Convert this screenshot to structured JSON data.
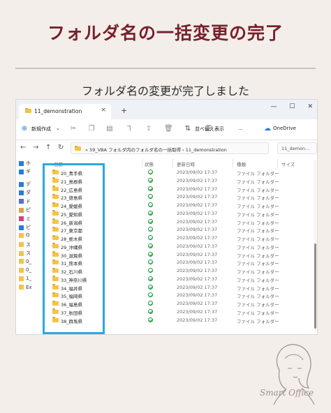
{
  "page": {
    "title": "フォルダ名の一括変更の完了",
    "subtitle": "フォルダ名の変更が完了しました",
    "brand": "Smart Office"
  },
  "window": {
    "tab_title": "11_demonstration",
    "tab_close": "×",
    "new_tab": "+",
    "minimize": "—",
    "maximize": "☐",
    "close": "✕"
  },
  "toolbar": {
    "new_label": "新規作成",
    "sort_label": "並べ替え",
    "view_label": "表示",
    "more_label": "...",
    "onedrive_label": "OneDrive"
  },
  "address": {
    "path": "59_VBA フォルダ内のフォルダ名の一括取得  ›  11_demonstration",
    "ellipsis": "«",
    "search_placeholder": "11_demon..."
  },
  "sidebar": {
    "items": [
      "ホ",
      "ギ",
      "デ",
      "ダ",
      "ド",
      "ピ",
      "ミ",
      "ビ",
      "O",
      "ス",
      "ス",
      "0_",
      "0_",
      "1_",
      "Ex"
    ]
  },
  "columns": {
    "name": "名前",
    "status": "状態",
    "modified": "更新日時",
    "type": "種類",
    "size": "サイズ"
  },
  "rows": [
    {
      "name": "20_青手県",
      "date": "2023/09/02 17:37",
      "type": "ファイル フォルダー"
    },
    {
      "name": "21_島根県",
      "date": "2023/09/02 17:37",
      "type": "ファイル フォルダー"
    },
    {
      "name": "22_広島県",
      "date": "2023/09/02 17:37",
      "type": "ファイル フォルダー"
    },
    {
      "name": "23_德島県",
      "date": "2023/09/02 17:37",
      "type": "ファイル フォルダー"
    },
    {
      "name": "24_愛媛県",
      "date": "2023/09/02 17:37",
      "type": "ファイル フォルダー"
    },
    {
      "name": "25_愛知県",
      "date": "2023/09/02 17:37",
      "type": "ファイル フォルダー"
    },
    {
      "name": "26_新潟県",
      "date": "2023/09/02 17:37",
      "type": "ファイル フォルダー"
    },
    {
      "name": "27_東京都",
      "date": "2023/09/02 17:37",
      "type": "ファイル フォルダー"
    },
    {
      "name": "28_栃木県",
      "date": "2023/09/02 17:37",
      "type": "ファイル フォルダー"
    },
    {
      "name": "29_沖縄県",
      "date": "2023/09/02 17:37",
      "type": "ファイル フォルダー"
    },
    {
      "name": "30_滋賀県",
      "date": "2023/09/02 17:37",
      "type": "ファイル フォルダー"
    },
    {
      "name": "31_熊本県",
      "date": "2023/09/02 17:37",
      "type": "ファイル フォルダー"
    },
    {
      "name": "32_石川県",
      "date": "2023/09/02 17:37",
      "type": "ファイル フォルダー"
    },
    {
      "name": "33_神奈川県",
      "date": "2023/09/02 17:37",
      "type": "ファイル フォルダー"
    },
    {
      "name": "34_福井県",
      "date": "2023/09/02 17:37",
      "type": "ファイル フォルダー"
    },
    {
      "name": "35_福岡県",
      "date": "2023/09/02 17:37",
      "type": "ファイル フォルダー"
    },
    {
      "name": "36_福島県",
      "date": "2023/09/02 17:37",
      "type": "ファイル フォルダー"
    },
    {
      "name": "37_秋田県",
      "date": "2023/09/02 17:37",
      "type": "ファイル フォルダー"
    },
    {
      "name": "38_群馬県",
      "date": "2023/09/02 17:37",
      "type": "ファイル フォルダー"
    }
  ],
  "colors": {
    "title": "#7a1f2b",
    "highlight": "#2aa9de",
    "folder": "#f3c34a",
    "sync_ok": "#1e9e3a",
    "background": "#f3eeea"
  }
}
